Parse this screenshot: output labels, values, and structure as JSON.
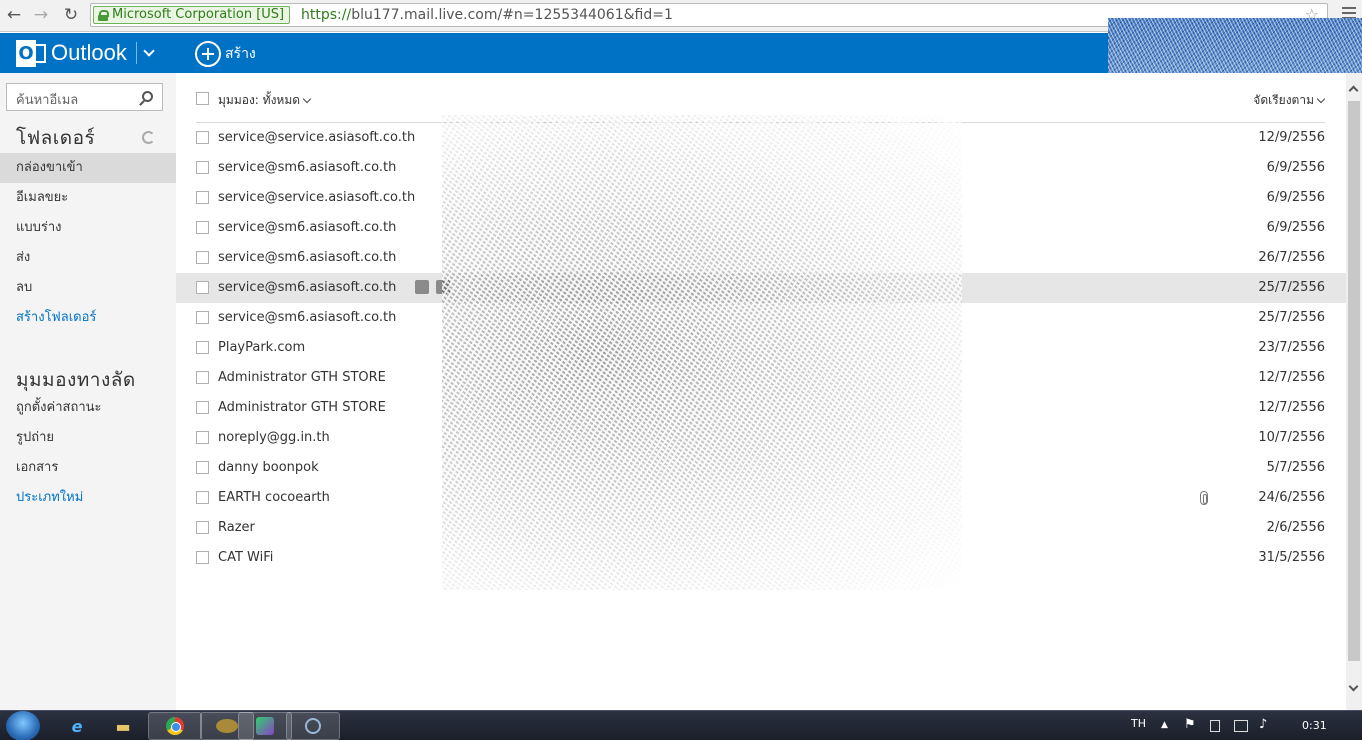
{
  "browser": {
    "ev_label": "Microsoft Corporation [US]",
    "url_scheme": "https://",
    "url_rest": "blu177.mail.live.com/#n=1255344061&fid=1",
    "back_glyph": "←",
    "forward_glyph": "→",
    "reload_glyph": "↻",
    "star_glyph": "☆"
  },
  "header": {
    "logo_letter": "O",
    "app_name": "Outlook",
    "new_label": "สร้าง",
    "color": "#0072c6"
  },
  "sidebar": {
    "search_placeholder": "ค้นหาอีเมล",
    "folders_title": "โฟลเดอร์",
    "folders": [
      {
        "label": "กล่องขาเข้า"
      },
      {
        "label": "อีเมลขยะ"
      },
      {
        "label": "แบบร่าง"
      },
      {
        "label": "ส่ง"
      },
      {
        "label": "ลบ"
      }
    ],
    "new_folder": "สร้างโฟลเดอร์",
    "quick_views_title": "มุมมองทางลัด",
    "quick_views": [
      {
        "label": "ถูกตั้งค่าสถานะ"
      },
      {
        "label": "รูปถ่าย"
      },
      {
        "label": "เอกสาร"
      }
    ],
    "new_category": "ประเภทใหม่"
  },
  "list": {
    "view_filter": "มุมมอง: ทั้งหมด",
    "sort_label": "จัดเรียงตาม",
    "rows": [
      {
        "sender": "service@service.asiasoft.co.th",
        "date": "12/9/2556"
      },
      {
        "sender": "service@sm6.asiasoft.co.th",
        "date": "6/9/2556"
      },
      {
        "sender": "service@service.asiasoft.co.th",
        "date": "6/9/2556"
      },
      {
        "sender": "service@sm6.asiasoft.co.th",
        "date": "6/9/2556"
      },
      {
        "sender": "service@sm6.asiasoft.co.th",
        "date": "26/7/2556"
      },
      {
        "sender": "service@sm6.asiasoft.co.th",
        "date": "25/7/2556"
      },
      {
        "sender": "service@sm6.asiasoft.co.th",
        "date": "25/7/2556"
      },
      {
        "sender": "PlayPark.com",
        "date": "23/7/2556"
      },
      {
        "sender": "Administrator GTH STORE",
        "date": "12/7/2556"
      },
      {
        "sender": "Administrator GTH STORE",
        "date": "12/7/2556"
      },
      {
        "sender": "noreply@gg.in.th",
        "date": "10/7/2556"
      },
      {
        "sender": "danny boonpok",
        "date": "5/7/2556"
      },
      {
        "sender": "EARTH cocoearth",
        "date": "24/6/2556"
      },
      {
        "sender": "Razer",
        "date": "2/6/2556"
      },
      {
        "sender": "CAT WiFi",
        "date": "31/5/2556"
      }
    ]
  },
  "taskbar": {
    "lang": "TH",
    "time": "0:31",
    "ie_glyph": "e",
    "folder_glyph": "▬",
    "tray_up_glyph": "▲",
    "flag_glyph": "⚑",
    "speaker_glyph": "♪"
  }
}
